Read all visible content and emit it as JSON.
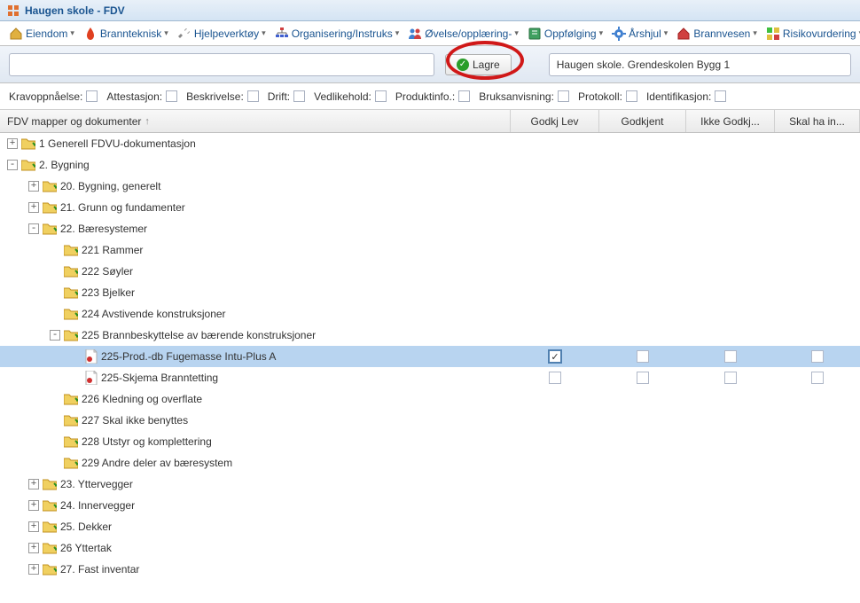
{
  "title": "Haugen skole - FDV",
  "toolbar": [
    {
      "label": "Eiendom",
      "icon": "home"
    },
    {
      "label": "Brannteknisk",
      "icon": "fire"
    },
    {
      "label": "Hjelpeverktøy",
      "icon": "tools"
    },
    {
      "label": "Organisering/Instruks",
      "icon": "org"
    },
    {
      "label": "Øvelse/opplæring-",
      "icon": "group"
    },
    {
      "label": "Oppfølging",
      "icon": "book"
    },
    {
      "label": "Årshjul",
      "icon": "gear"
    },
    {
      "label": "Brannvesen",
      "icon": "bhome"
    },
    {
      "label": "Risikovurdering",
      "icon": "risk"
    }
  ],
  "save_label": "Lagre",
  "path_text": "Haugen skole. Grendeskolen Bygg 1",
  "filters": [
    "Kravoppnåelse:",
    "Attestasjon:",
    "Beskrivelse:",
    "Drift:",
    "Vedlikehold:",
    "Produktinfo.:",
    "Bruksanvisning:",
    "Protokoll:",
    "Identifikasjon:"
  ],
  "columns": {
    "tree": "FDV mapper og dokumenter",
    "godkj_lev": "Godkj Lev",
    "godkjent": "Godkjent",
    "ikke_godkj": "Ikke Godkj...",
    "skal_ha": "Skal ha in..."
  },
  "tree": [
    {
      "depth": 0,
      "type": "folder",
      "exp": "+",
      "label": "1 Generell FDVU-dokumentasjon"
    },
    {
      "depth": 0,
      "type": "folder",
      "exp": "-",
      "label": "2. Bygning"
    },
    {
      "depth": 1,
      "type": "folder",
      "exp": "+",
      "label": "20. Bygning, generelt"
    },
    {
      "depth": 1,
      "type": "folder",
      "exp": "+",
      "label": "21. Grunn og fundamenter"
    },
    {
      "depth": 1,
      "type": "folder",
      "exp": "-",
      "label": "22. Bæresystemer"
    },
    {
      "depth": 2,
      "type": "folder",
      "exp": "",
      "label": "221 Rammer"
    },
    {
      "depth": 2,
      "type": "folder",
      "exp": "",
      "label": "222 Søyler"
    },
    {
      "depth": 2,
      "type": "folder",
      "exp": "",
      "label": "223 Bjelker"
    },
    {
      "depth": 2,
      "type": "folder",
      "exp": "",
      "label": "224 Avstivende konstruksjoner"
    },
    {
      "depth": 2,
      "type": "folder",
      "exp": "-",
      "label": "225 Brannbeskyttelse av bærende konstruksjoner"
    },
    {
      "depth": 3,
      "type": "doc",
      "label": "225-Prod.-db Fugemasse Intu-Plus A",
      "selected": true,
      "godkj_lev": true,
      "cb": true
    },
    {
      "depth": 3,
      "type": "doc",
      "label": "225-Skjema Branntetting",
      "cb": true
    },
    {
      "depth": 2,
      "type": "folder",
      "exp": "",
      "label": "226 Kledning og overflate"
    },
    {
      "depth": 2,
      "type": "folder",
      "exp": "",
      "label": "227 Skal ikke benyttes"
    },
    {
      "depth": 2,
      "type": "folder",
      "exp": "",
      "label": "228 Utstyr og komplettering"
    },
    {
      "depth": 2,
      "type": "folder",
      "exp": "",
      "label": "229 Andre deler av bæresystem"
    },
    {
      "depth": 1,
      "type": "folder",
      "exp": "+",
      "label": "23. Yttervegger"
    },
    {
      "depth": 1,
      "type": "folder",
      "exp": "+",
      "label": "24. Innervegger"
    },
    {
      "depth": 1,
      "type": "folder",
      "exp": "+",
      "label": "25. Dekker"
    },
    {
      "depth": 1,
      "type": "folder",
      "exp": "+",
      "label": "26 Yttertak"
    },
    {
      "depth": 1,
      "type": "folder",
      "exp": "+",
      "label": "27. Fast inventar"
    }
  ]
}
